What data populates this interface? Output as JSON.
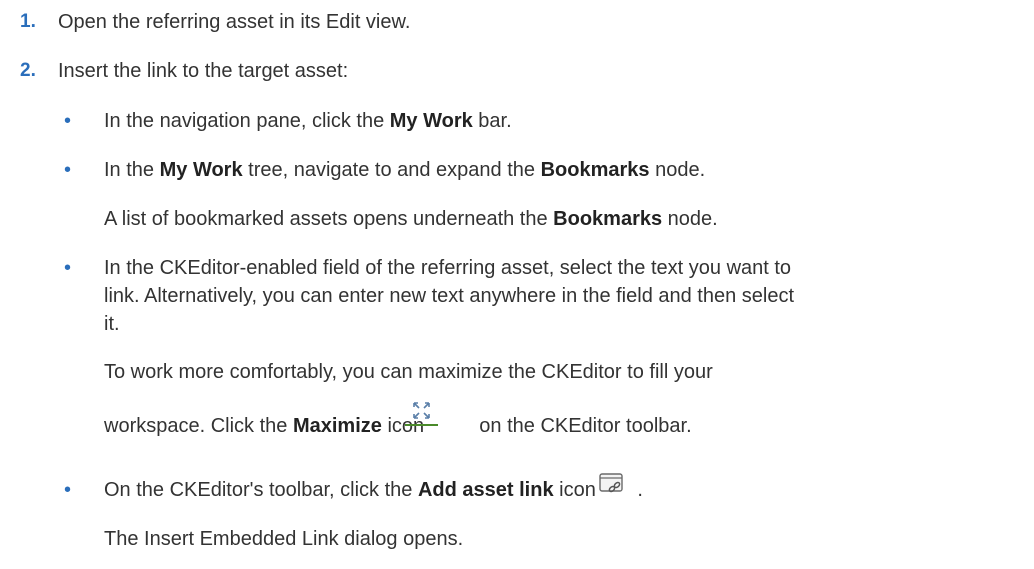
{
  "steps": [
    {
      "number": "1.",
      "text": "Open the referring asset in its Edit view."
    },
    {
      "number": "2.",
      "text": "Insert the link to the target asset:"
    }
  ],
  "bullets": {
    "b1": {
      "pre": "In the navigation pane, click the ",
      "bold": "My Work",
      "post": " bar."
    },
    "b2": {
      "pre": "In the ",
      "bold1": "My Work",
      "mid": " tree, navigate to and expand the ",
      "bold2": "Bookmarks",
      "post": " node."
    },
    "b2_note": {
      "pre": "A list of bookmarked assets opens underneath the ",
      "bold": "Bookmarks",
      "post": " node."
    },
    "b3": {
      "line1": "In the CKEditor-enabled field of the referring asset, select the text you want to",
      "line2": "link. Alternatively, you can enter new text anywhere in the field and then select",
      "line3": "it."
    },
    "b3_note": {
      "line1": "To work more comfortably, you can maximize the CKEditor to fill your",
      "pre": "workspace. Click the ",
      "bold": "Maximize",
      "mid": " icon ",
      "post": " on the CKEditor toolbar."
    },
    "b4": {
      "pre": "On the CKEditor's toolbar, click the ",
      "bold": "Add asset link",
      "mid": " icon ",
      "post": "."
    },
    "b4_note": {
      "text": "The Insert Embedded Link dialog opens."
    }
  },
  "icons": {
    "maximize": "maximize-icon",
    "add_asset_link": "add-asset-link-icon"
  },
  "colors": {
    "accent": "#2a6ebb",
    "text": "#333333"
  }
}
